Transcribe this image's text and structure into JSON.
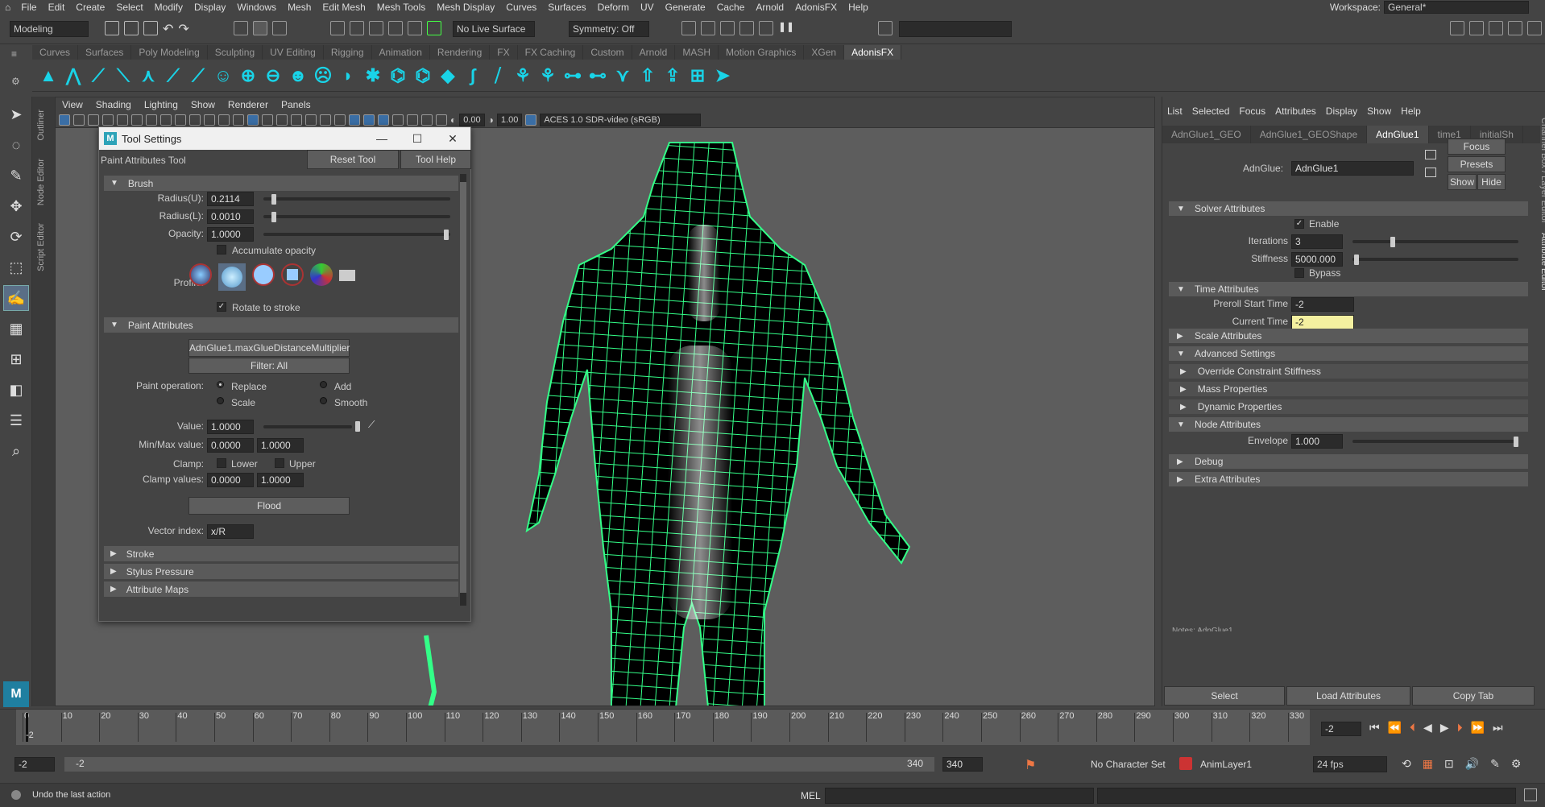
{
  "menubar": [
    "File",
    "Edit",
    "Create",
    "Select",
    "Modify",
    "Display",
    "Windows",
    "Mesh",
    "Edit Mesh",
    "Mesh Tools",
    "Mesh Display",
    "Curves",
    "Surfaces",
    "Deform",
    "UV",
    "Generate",
    "Cache",
    "Arnold",
    "AdonisFX",
    "Help"
  ],
  "workspace": {
    "label": "Workspace:",
    "value": "General*"
  },
  "status": {
    "mode": "Modeling",
    "live_surface": "No Live Surface",
    "symmetry": "Symmetry: Off"
  },
  "shelf_tabs": [
    "Curves",
    "Surfaces",
    "Poly Modeling",
    "Sculpting",
    "UV Editing",
    "Rigging",
    "Animation",
    "Rendering",
    "FX",
    "FX Caching",
    "Custom",
    "Arnold",
    "MASH",
    "Motion Graphics",
    "XGen",
    "AdonisFX"
  ],
  "shelf_active": "AdonisFX",
  "side_tabs": [
    "Outliner",
    "Node Editor",
    "Script Editor"
  ],
  "right_side_tabs": [
    "Channel Box / Layer Editor",
    "Attribute Editor"
  ],
  "viewport": {
    "menu": [
      "View",
      "Shading",
      "Lighting",
      "Show",
      "Renderer",
      "Panels"
    ],
    "exposure": "0.00",
    "gamma": "1.00",
    "color_space": "ACES 1.0 SDR-video (sRGB)"
  },
  "tool_settings": {
    "title": "Tool Settings",
    "tool_name": "Paint Attributes Tool",
    "reset": "Reset Tool",
    "help": "Tool Help",
    "brush": {
      "title": "Brush",
      "radius_u_label": "Radius(U):",
      "radius_u": "0.2114",
      "radius_l_label": "Radius(L):",
      "radius_l": "0.0010",
      "opacity_label": "Opacity:",
      "opacity": "1.0000",
      "accumulate": "Accumulate opacity",
      "profile_label": "Profile:",
      "rotate": "Rotate to stroke"
    },
    "paint": {
      "title": "Paint Attributes",
      "attribute": "AdnGlue1.maxGlueDistanceMultiplier",
      "filter": "Filter: All",
      "op_label": "Paint operation:",
      "ops": [
        "Replace",
        "Add",
        "Scale",
        "Smooth"
      ],
      "value_label": "Value:",
      "value": "1.0000",
      "minmax_label": "Min/Max value:",
      "min": "0.0000",
      "max": "1.0000",
      "clamp_label": "Clamp:",
      "lower": "Lower",
      "upper": "Upper",
      "clampv_label": "Clamp values:",
      "cmin": "0.0000",
      "cmax": "1.0000",
      "flood": "Flood",
      "vector_label": "Vector index:",
      "vector": "x/R"
    },
    "collapsed": [
      "Stroke",
      "Stylus Pressure",
      "Attribute Maps"
    ]
  },
  "attribute_editor": {
    "menu": [
      "List",
      "Selected",
      "Focus",
      "Attributes",
      "Display",
      "Show",
      "Help"
    ],
    "tabs": [
      "AdnGlue1_GEO",
      "AdnGlue1_GEOShape",
      "AdnGlue1",
      "time1",
      "initialSh"
    ],
    "active_tab": "AdnGlue1",
    "node_label": "AdnGlue:",
    "node_name": "AdnGlue1",
    "focus": "Focus",
    "presets": "Presets",
    "show": "Show",
    "hide": "Hide",
    "solver": {
      "title": "Solver Attributes",
      "enable": "Enable",
      "iter_label": "Iterations",
      "iter": "3",
      "stiff_label": "Stiffness",
      "stiff": "5000.000",
      "bypass": "Bypass"
    },
    "time": {
      "title": "Time Attributes",
      "preroll_label": "Preroll Start Time",
      "preroll": "-2",
      "current_label": "Current Time",
      "current": "-2"
    },
    "scale": "Scale Attributes",
    "advanced": "Advanced Settings",
    "advanced_sub": [
      "Override Constraint Stiffness",
      "Mass Properties",
      "Dynamic Properties"
    ],
    "node": {
      "title": "Node Attributes",
      "env_label": "Envelope",
      "env": "1.000"
    },
    "debug": "Debug",
    "extra": "Extra Attributes",
    "notes": "Notes: AdnGlue1",
    "buttons": [
      "Select",
      "Load Attributes",
      "Copy Tab"
    ]
  },
  "timeline": {
    "ticks": [
      "0",
      "10",
      "20",
      "30",
      "40",
      "50",
      "60",
      "70",
      "80",
      "90",
      "100",
      "110",
      "120",
      "130",
      "140",
      "150",
      "160",
      "170",
      "180",
      "190",
      "200",
      "210",
      "220",
      "230",
      "240",
      "250",
      "260",
      "270",
      "280",
      "290",
      "300",
      "310",
      "320",
      "330"
    ],
    "start_marker": "-2",
    "current": "-2"
  },
  "range": {
    "start": "-2",
    "inner_start": "-2",
    "inner_end": "340",
    "end": "340",
    "character": "No Character Set",
    "anim_layer": "AnimLayer1",
    "fps": "24 fps"
  },
  "cmd": {
    "help": "Undo the last action",
    "lang": "MEL"
  }
}
